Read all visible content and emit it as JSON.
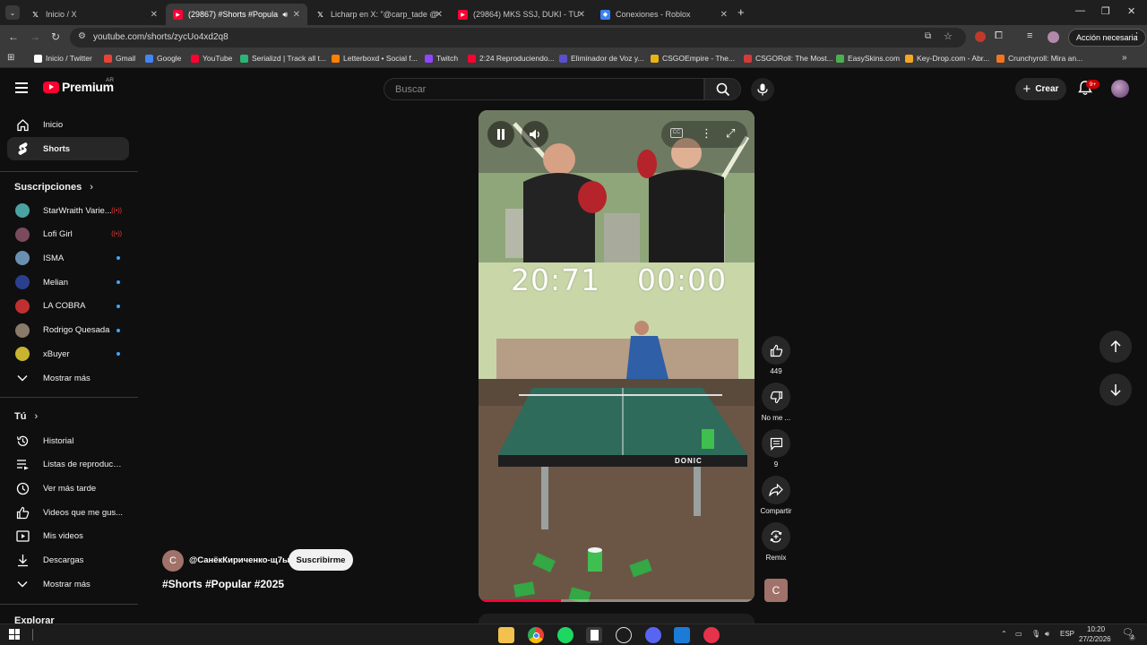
{
  "browser": {
    "tabs": [
      {
        "title": "Inicio / X",
        "icon": "x-logo",
        "active": false
      },
      {
        "title": "(29867) #Shorts #Popular #",
        "icon": "youtube-logo",
        "active": true
      },
      {
        "title": "Licharp en X: \"@carp_tade @SI",
        "icon": "x-logo",
        "active": false
      },
      {
        "title": "(29864) MKS SSJ, DUKI - TU SIL",
        "icon": "youtube-logo",
        "active": false
      },
      {
        "title": "Conexiones - Roblox",
        "icon": "roblox-logo",
        "active": false
      }
    ],
    "url": "youtube.com/shorts/zycUo4xd2q8",
    "action_button": "Acción necesaria",
    "bookmarks": [
      {
        "label": "Inicio / Twitter",
        "color": "#ffffff"
      },
      {
        "label": "Gmail",
        "color": "#ea4335"
      },
      {
        "label": "Google",
        "color": "#4285f4"
      },
      {
        "label": "YouTube",
        "color": "#ff0033"
      },
      {
        "label": "Serializd | Track all t...",
        "color": "#2bb673"
      },
      {
        "label": "Letterboxd • Social f...",
        "color": "#ff8000"
      },
      {
        "label": "Twitch",
        "color": "#9146ff"
      },
      {
        "label": "2:24 Reproduciendo...",
        "color": "#ff0033"
      },
      {
        "label": "Eliminador de Voz y...",
        "color": "#5a4fcf"
      },
      {
        "label": "CSGOEmpire - The...",
        "color": "#e7b416"
      },
      {
        "label": "CSGORoll: The Most...",
        "color": "#d33b3b"
      },
      {
        "label": "EasySkins.com",
        "color": "#4caf50"
      },
      {
        "label": "Key-Drop.com - Abr...",
        "color": "#f5a623"
      },
      {
        "label": "Crunchyroll: Mira an...",
        "color": "#f47521"
      }
    ]
  },
  "header": {
    "logo_text": "Premium",
    "region": "AR",
    "search_placeholder": "Buscar",
    "create_label": "Crear",
    "notifications_badge": "9+"
  },
  "sidebar": {
    "primary": [
      {
        "label": "Inicio",
        "icon": "home-icon",
        "active": false
      },
      {
        "label": "Shorts",
        "icon": "shorts-icon",
        "active": true
      }
    ],
    "subscriptions_title": "Suscripciones",
    "subscriptions": [
      {
        "label": "StarWraith Varie...",
        "indicator": "live",
        "color": "#4aa3a0"
      },
      {
        "label": "Lofi Girl",
        "indicator": "live",
        "color": "#7a4b5c"
      },
      {
        "label": "ISMA",
        "indicator": "dot",
        "color": "#6b8fb0"
      },
      {
        "label": "Melian",
        "indicator": "dot",
        "color": "#2b3f8f"
      },
      {
        "label": "LA COBRA",
        "indicator": "dot",
        "color": "#c03030"
      },
      {
        "label": "Rodrigo Quesada",
        "indicator": "dot",
        "color": "#8a7a6a"
      },
      {
        "label": "xBuyer",
        "indicator": "dot",
        "color": "#c8b430"
      }
    ],
    "show_more": "Mostrar más",
    "you_title": "Tú",
    "you_items": [
      {
        "label": "Historial",
        "icon": "history-icon"
      },
      {
        "label": "Listas de reproducc...",
        "icon": "playlists-icon"
      },
      {
        "label": "Ver más tarde",
        "icon": "watch-later-icon"
      },
      {
        "label": "Videos que me gus...",
        "icon": "liked-icon"
      },
      {
        "label": "Mis videos",
        "icon": "my-videos-icon"
      },
      {
        "label": "Descargas",
        "icon": "downloads-icon"
      }
    ],
    "show_more_2": "Mostrar más",
    "explore_title": "Explorar"
  },
  "video": {
    "score_left": "20:71",
    "score_right": "00:00",
    "brand": "DONIC",
    "progress": 0.3,
    "channel_initial": "C",
    "channel_name": "@СанёкКириченко-щ7ы",
    "subscribe_label": "Suscribirme",
    "title": "#Shorts #Popular #2025"
  },
  "actions": {
    "likes": "449",
    "dislike": "No me ...",
    "comments": "9",
    "share": "Compartir",
    "remix": "Remix",
    "remix_initial": "C"
  },
  "taskbar": {
    "language": "ESP",
    "time": "10:20",
    "date": "27/2/2026",
    "notifications": "2"
  }
}
